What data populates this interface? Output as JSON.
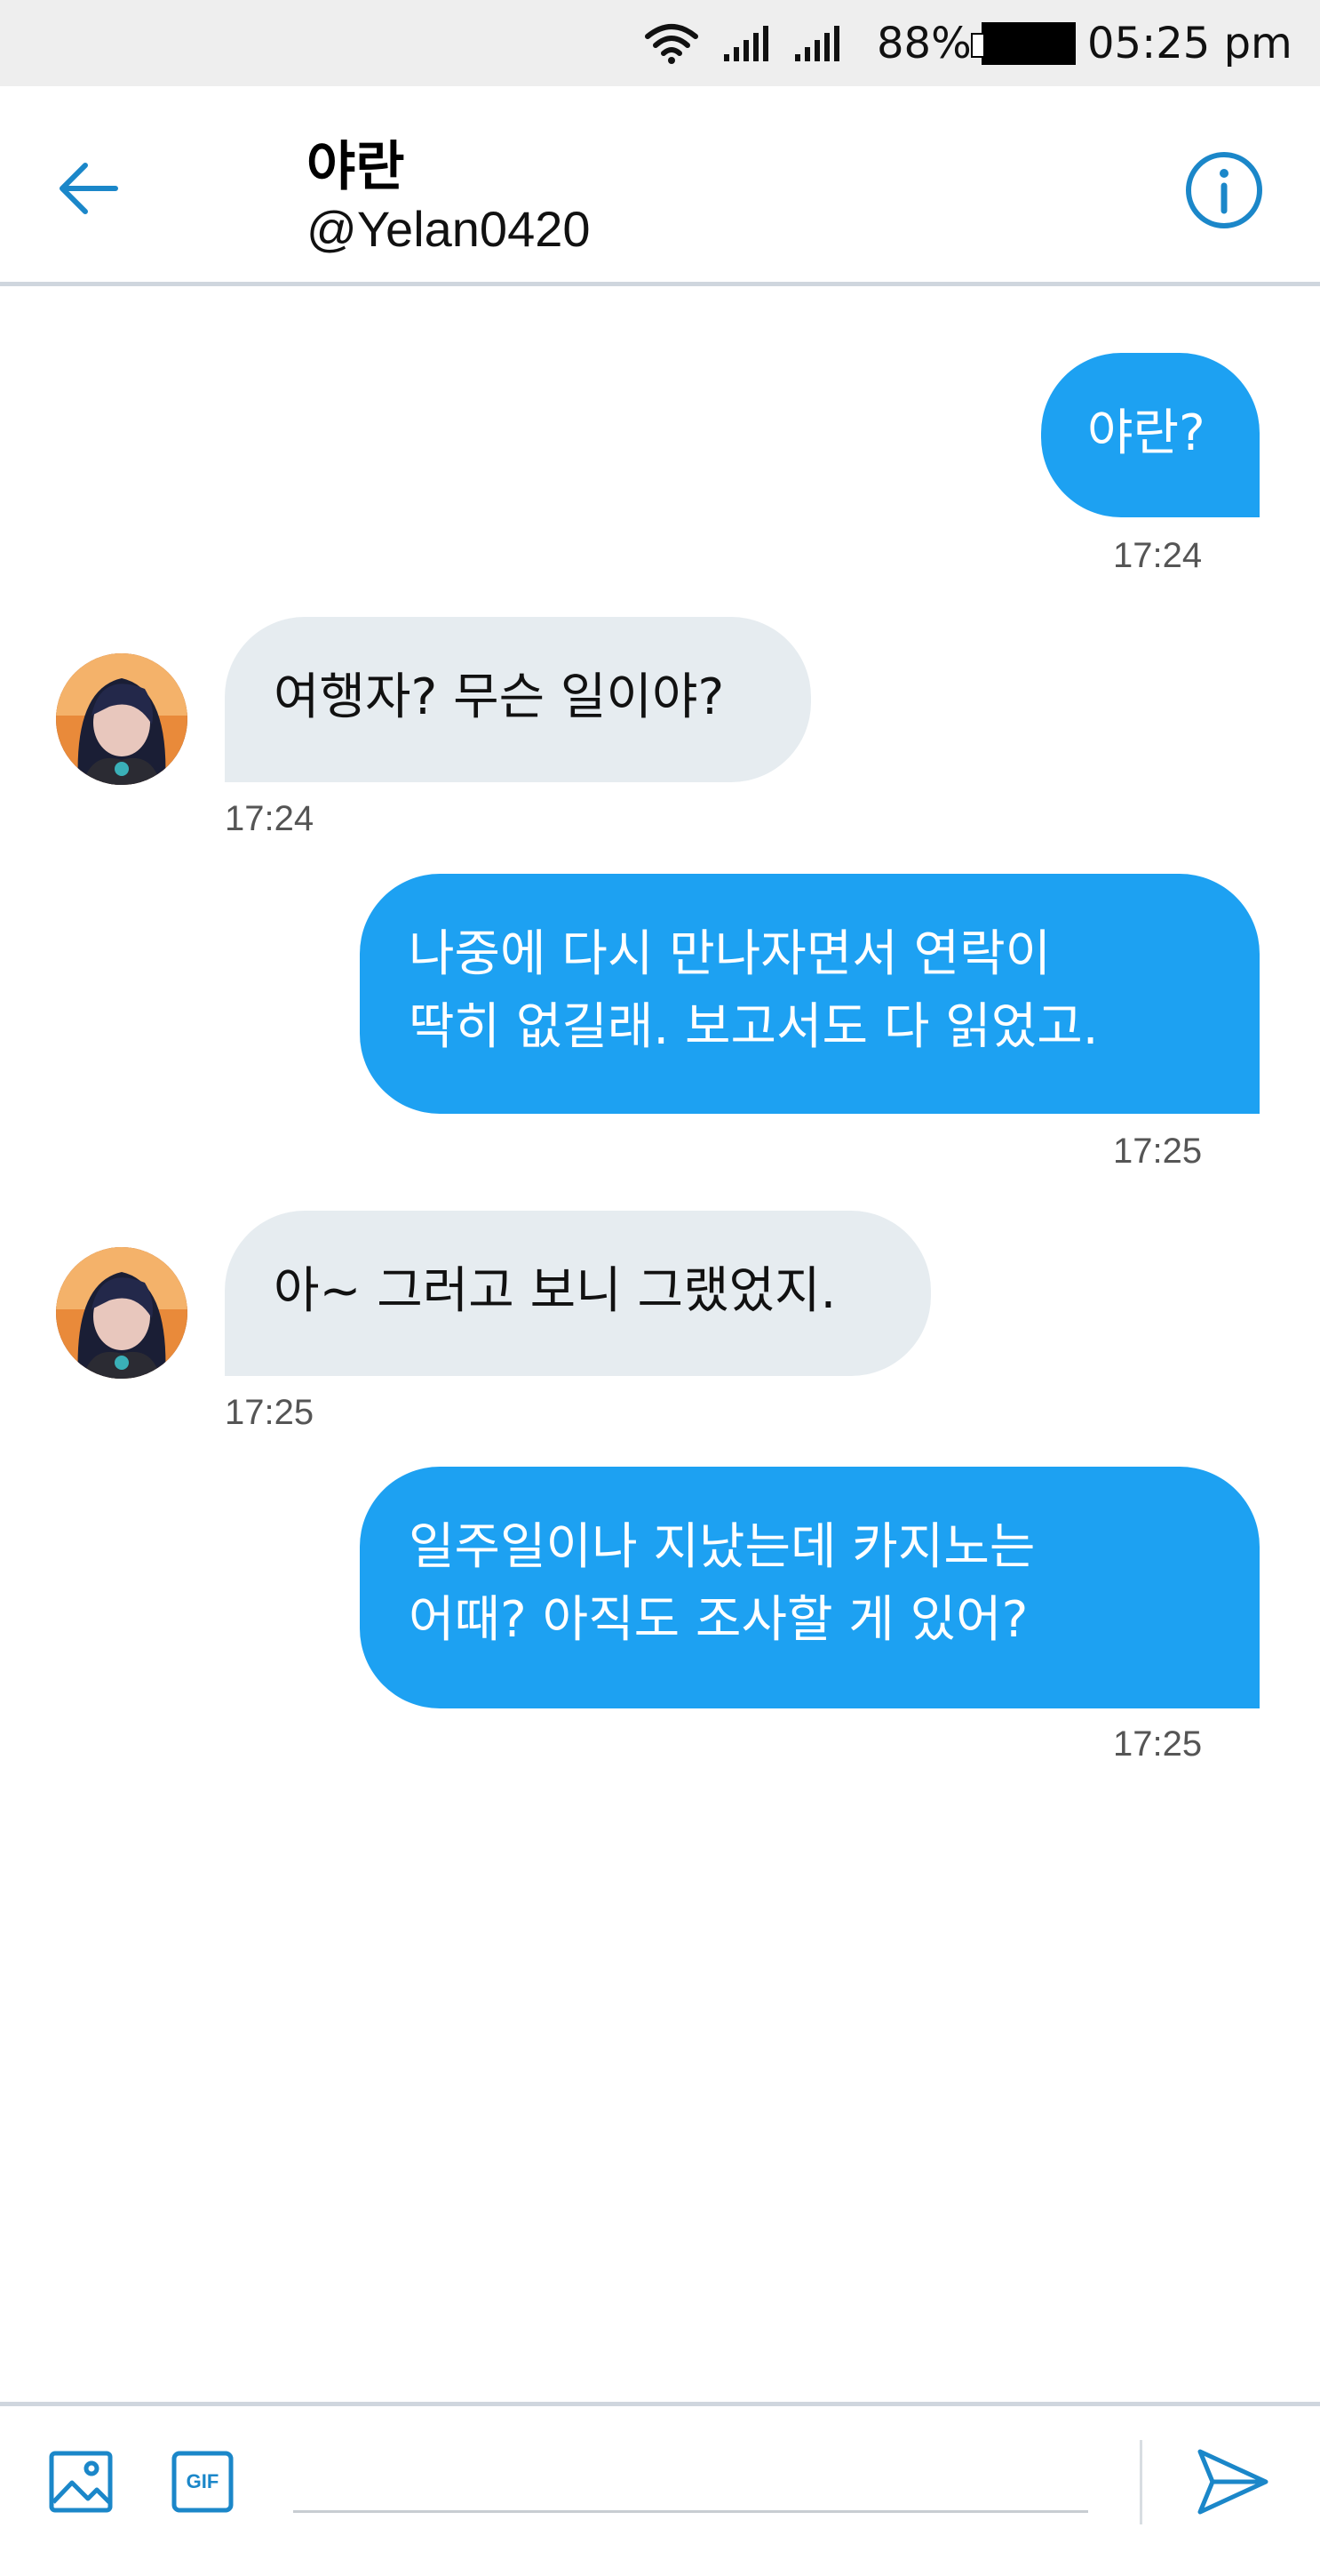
{
  "status_bar": {
    "battery_percent": "88%",
    "time": "05:25 pm"
  },
  "header": {
    "name": "야란",
    "handle": "@Yelan0420"
  },
  "messages": [
    {
      "direction": "outgoing",
      "text": "야란?",
      "time": "17:24"
    },
    {
      "direction": "incoming",
      "text": "여행자? 무슨 일이야?",
      "time": "17:24"
    },
    {
      "direction": "outgoing",
      "text": "나중에 다시 만나자면서 연락이\n딱히 없길래. 보고서도 다 읽었고.",
      "time": "17:25"
    },
    {
      "direction": "incoming",
      "text": "아~ 그러고 보니 그랬었지.",
      "time": "17:25"
    },
    {
      "direction": "outgoing",
      "text": "일주일이나 지났는데 카지노는\n어때? 아직도 조사할 게 있어?",
      "time": "17:25"
    }
  ],
  "composer": {
    "placeholder": "",
    "gif_label": "GIF"
  },
  "colors": {
    "accent": "#1da1f2",
    "incoming_bubble": "#e6ecf0",
    "icon_blue": "#1b87c9"
  }
}
